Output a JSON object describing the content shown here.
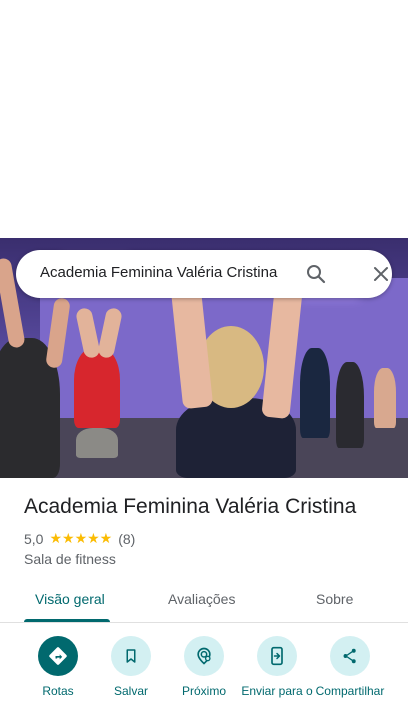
{
  "search": {
    "query": "Academia Feminina Valéria Cristina"
  },
  "place": {
    "title": "Academia Feminina Valéria Cristina",
    "rating": "5,0",
    "stars": "★★★★★",
    "review_count": "(8)",
    "category": "Sala de fitness"
  },
  "tabs": [
    {
      "label": "Visão geral",
      "active": true
    },
    {
      "label": "Avaliações",
      "active": false
    },
    {
      "label": "Sobre",
      "active": false
    }
  ],
  "actions": [
    {
      "label": "Rotas",
      "icon": "directions-icon"
    },
    {
      "label": "Salvar",
      "icon": "bookmark-icon"
    },
    {
      "label": "Próximo",
      "icon": "nearby-icon"
    },
    {
      "label": "Enviar para o",
      "icon": "send-to-phone-icon"
    },
    {
      "label": "Compartilhar",
      "icon": "share-icon"
    }
  ],
  "colors": {
    "accent": "#01696e",
    "accent_light": "#d3f0f2",
    "star": "#fbbc04"
  }
}
